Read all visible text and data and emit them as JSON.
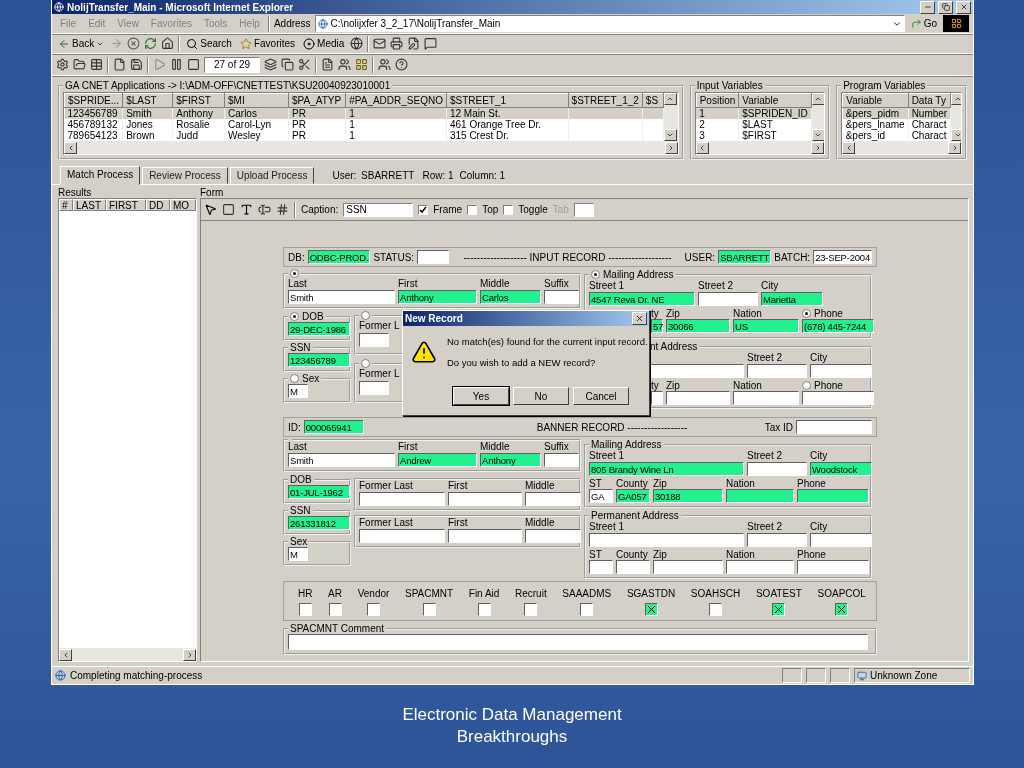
{
  "window": {
    "title": "NolijTransfer_Main - Microsoft Internet Explorer"
  },
  "menu": [
    "File",
    "Edit",
    "View",
    "Favorites",
    "Tools",
    "Help"
  ],
  "address": {
    "label": "Address",
    "value": "C:\\nolijxfer 3_2_17\\NolijTransfer_Main",
    "go": "Go"
  },
  "browser_toolbar": {
    "back": "Back",
    "search": "Search",
    "favorites": "Favorites",
    "media": "Media"
  },
  "app_toolbar": {
    "record_position": "27 of 29"
  },
  "source": {
    "title": "GA CNET Applications -> I:\\ADM-OFF\\CNETTEST\\KSU20040923010001",
    "columns": [
      "$SPRIDE...",
      "$LAST",
      "$FIRST",
      "$MI",
      "$PA_ATYP",
      "#PA_ADDR_SEQNO",
      "$STREET_1",
      "$STREET_1_2",
      "$S"
    ],
    "rows": [
      {
        "cells": [
          "123456789",
          "Smith",
          "Anthony",
          "Carlos",
          "PR",
          "1",
          "12 Main St."
        ],
        "selected": true
      },
      {
        "cells": [
          "456789132",
          "Jones",
          "Rosalie",
          "Carol-Lyn",
          "PR",
          "1",
          "461 Orange Tree Dr."
        ],
        "selected": false
      },
      {
        "cells": [
          "789654123",
          "Brown",
          "Judd",
          "Wesley",
          "PR",
          "1",
          "315 Crest Dr."
        ],
        "selected": false
      }
    ]
  },
  "input_variables": {
    "title": "Input Variables",
    "columns": [
      "Position",
      "Variable"
    ],
    "rows": [
      {
        "cells": [
          "1",
          "$SPRIDEN_ID"
        ],
        "selected": true
      },
      {
        "cells": [
          "2",
          "$LAST"
        ],
        "selected": false
      },
      {
        "cells": [
          "3",
          "$FIRST"
        ],
        "selected": false
      }
    ]
  },
  "program_variables": {
    "title": "Program Variables",
    "columns": [
      "Variable",
      "Data Ty"
    ],
    "rows": [
      {
        "cells": [
          "&pers_pidm",
          "Number"
        ],
        "selected": true
      },
      {
        "cells": [
          "&pers_lname",
          "Charact"
        ],
        "selected": false
      },
      {
        "cells": [
          "&pers_id",
          "Charact"
        ],
        "selected": false
      }
    ]
  },
  "tabs": [
    {
      "label": "Match Process",
      "selected": true
    },
    {
      "label": "Review Process",
      "selected": false
    },
    {
      "label": "Upload Process",
      "selected": false
    }
  ],
  "session": {
    "user": "User: SBARRETT",
    "row": "Row: 1",
    "column": "Column: 1"
  },
  "results": {
    "title": "Results",
    "columns": [
      "#",
      "LAST",
      "FIRST",
      "DD",
      "MO"
    ]
  },
  "form": {
    "title": "Form",
    "caption_label": "Caption:",
    "caption_value": "SSN",
    "options": [
      {
        "label": "Frame",
        "checked": true
      },
      {
        "label": "Top",
        "checked": false
      },
      {
        "label": "Toggle",
        "checked": false
      }
    ],
    "tab_label": "Tab",
    "tab_disabled": true
  },
  "input_record": {
    "db_label": "DB:",
    "db": "ODBC-PROD.",
    "status_label": "STATUS:",
    "title": "------------------- INPUT RECORD -------------------",
    "user_label": "USER:",
    "user": "SBARRETT",
    "batch_label": "BATCH:",
    "batch": "23-SEP-2004",
    "name": {
      "selected": true,
      "fields": [
        {
          "label": "Last",
          "value": "Smith",
          "matched": false
        },
        {
          "label": "First",
          "value": "Anthony",
          "matched": true
        },
        {
          "label": "Middle",
          "value": "Carlos",
          "matched": true
        },
        {
          "label": "Suffix",
          "matched": false
        }
      ]
    },
    "dob": {
      "label": "DOB",
      "selected": true,
      "value": "29-DEC-1986",
      "matched": true
    },
    "ssn": {
      "label": "SSN",
      "value": "123456789",
      "matched": true
    },
    "sex": {
      "label": "Sex",
      "selected": false,
      "value": "M",
      "matched": false
    },
    "former": [
      {
        "label": "Former L",
        "selected": false
      },
      {
        "label": "Former L",
        "selected": false
      }
    ],
    "mailing": {
      "title": "Mailing Address",
      "selected": true,
      "row1": [
        {
          "label": "Street 1",
          "value": "4547 Reva Dr. NE",
          "matched": true
        },
        {
          "label": "Street 2",
          "matched": false
        },
        {
          "label": "City",
          "value": "Marietta",
          "matched": true
        }
      ],
      "row2": [
        {
          "kind": "plain",
          "label": "ty",
          "value": "57",
          "matched": true
        },
        {
          "kind": "plain",
          "label": "Zip",
          "value": "30066",
          "matched": true
        },
        {
          "kind": "plain",
          "label": "Nation",
          "value": "US",
          "matched": true
        },
        {
          "kind": "radio",
          "label": "Phone",
          "value": "(678) 445-7244",
          "matched": true,
          "selected": true
        }
      ]
    },
    "permanent": {
      "title": "nt Address",
      "row1": [
        {
          "matched": false
        },
        {
          "label": "Street 2",
          "matched": false
        },
        {
          "label": "City",
          "matched": false
        }
      ],
      "row2": [
        {
          "kind": "plain",
          "label": "ty",
          "matched": false
        },
        {
          "kind": "plain",
          "label": "Zip",
          "matched": false
        },
        {
          "kind": "plain",
          "label": "Nation",
          "matched": false
        },
        {
          "kind": "radio",
          "label": "Phone",
          "matched": false,
          "selected": false
        }
      ]
    }
  },
  "banner_record": {
    "id_label": "ID:",
    "id": "000065941",
    "title": "BANNER RECORD ------------------",
    "tax_label": "Tax ID",
    "name": {
      "fields": [
        {
          "label": "Last",
          "value": "Smith",
          "matched": false
        },
        {
          "label": "First",
          "value": "Andrew",
          "matched": true
        },
        {
          "label": "Middle",
          "value": "Anthony",
          "matched": true
        },
        {
          "label": "Suffix",
          "matched": false
        }
      ]
    },
    "dob": {
      "label": "DOB",
      "value": "01-JUL-1962",
      "matched": true
    },
    "ssn": {
      "label": "SSN",
      "value": "261331812",
      "matched": true
    },
    "sex": {
      "label": "Sex",
      "value": "M",
      "matched": false
    },
    "former": [
      {
        "fields": [
          {
            "label": "Former Last",
            "matched": false
          },
          {
            "label": "First",
            "matched": false
          },
          {
            "label": "Middle",
            "matched": false
          }
        ]
      },
      {
        "fields": [
          {
            "label": "Former Last",
            "matched": false
          },
          {
            "label": "First",
            "matched": false
          },
          {
            "label": "Middle",
            "matched": false
          }
        ]
      }
    ],
    "mailing": {
      "title": "Mailing Address",
      "row1": [
        {
          "label": "Street 1",
          "value": "805 Brandy Wine Ln",
          "matched": true
        },
        {
          "label": "Street 2",
          "matched": false
        },
        {
          "label": "City",
          "value": "Woodstock",
          "matched": true
        }
      ],
      "row2": [
        {
          "label": "ST",
          "value": "GA",
          "matched": false
        },
        {
          "label": "County",
          "value": "GA057",
          "matched": true
        },
        {
          "label": "Zip",
          "value": "30188",
          "matched": true
        },
        {
          "label": "Nation",
          "matched": true
        },
        {
          "label": "Phone",
          "matched": true
        }
      ]
    },
    "permanent": {
      "title": "Permanent Address",
      "row1": [
        {
          "label": "Street 1",
          "matched": false
        },
        {
          "label": "Street 2",
          "matched": false
        },
        {
          "label": "City",
          "matched": false
        }
      ],
      "row2": [
        {
          "label": "ST",
          "matched": false
        },
        {
          "label": "County",
          "matched": false
        },
        {
          "label": "Zip",
          "matched": false
        },
        {
          "label": "Nation",
          "matched": false
        },
        {
          "label": "Phone",
          "matched": false
        }
      ]
    }
  },
  "systems": [
    {
      "label": "HR",
      "checked": false
    },
    {
      "label": "AR",
      "checked": false
    },
    {
      "label": "Vendor",
      "checked": false
    },
    {
      "label": "SPACMNT",
      "checked": false
    },
    {
      "label": "Fin Aid",
      "checked": false
    },
    {
      "label": "Recruit",
      "checked": false
    },
    {
      "label": "SAAADMS",
      "checked": false
    },
    {
      "label": "SGASTDN",
      "checked": true
    },
    {
      "label": "SOAHSCH",
      "checked": false
    },
    {
      "label": "SOATEST",
      "checked": true
    },
    {
      "label": "SOAPCOL",
      "checked": true
    }
  ],
  "comment": {
    "label": "SPACMNT Comment"
  },
  "dialog": {
    "title": "New Record",
    "message": "No match(es) found for the current input record.",
    "question": "Do you wish to add a NEW record?",
    "buttons": [
      {
        "label": "Yes",
        "selected": true
      },
      {
        "label": "No",
        "selected": false
      },
      {
        "label": "Cancel",
        "selected": false
      }
    ]
  },
  "status_bar": {
    "text": "Completing matching-process",
    "zone": "Unknown Zone"
  },
  "slide": {
    "caption": [
      "Electronic Data Management",
      "Breakthroughs"
    ]
  }
}
